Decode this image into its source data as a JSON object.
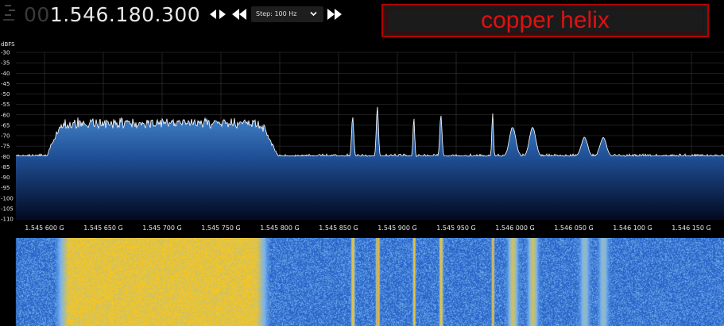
{
  "toolbar": {
    "frequency_leading": "00",
    "frequency_main": "1.546.180.300",
    "step_label": "Step: 100 Hz",
    "icons": [
      "menu-icon",
      "tune-left-right-icon",
      "rewind-icon",
      "chevron-down-icon",
      "fast-forward-icon"
    ]
  },
  "label_box": {
    "text": "copper helix",
    "color": "#e01010",
    "border_color": "#b30000"
  },
  "spectrum": {
    "unit": "dBFS",
    "y_ticks": [
      "-30",
      "-35",
      "-40",
      "-45",
      "-50",
      "-55",
      "-60",
      "-65",
      "-70",
      "-75",
      "-80",
      "-85",
      "-90",
      "-95",
      "-100",
      "-105",
      "-110"
    ],
    "y_range": [
      -110,
      -30
    ],
    "x_ticks": [
      "1.545 600 G",
      "1.545 650 G",
      "1.545 700 G",
      "1.545 750 G",
      "1.545 800 G",
      "1.545 850 G",
      "1.545 900 G",
      "1.545 950 G",
      "1.546 000 G",
      "1.546 050 G",
      "1.546 100 G",
      "1.546 150 G"
    ],
    "noise_floor_dbfs": -80,
    "wideband_signal": {
      "start_mhz": 1545.62,
      "end_mhz": 1545.78,
      "level_dbfs": -64
    },
    "narrow_peaks": [
      {
        "freq_mhz": 1545.862,
        "level_dbfs": -61,
        "width_khz": 2
      },
      {
        "freq_mhz": 1545.883,
        "level_dbfs": -56,
        "width_khz": 2
      },
      {
        "freq_mhz": 1545.914,
        "level_dbfs": -61,
        "width_khz": 1.5
      },
      {
        "freq_mhz": 1545.937,
        "level_dbfs": -60,
        "width_khz": 2
      },
      {
        "freq_mhz": 1545.981,
        "level_dbfs": -59,
        "width_khz": 1.5
      },
      {
        "freq_mhz": 1545.998,
        "level_dbfs": -66,
        "width_khz": 6
      },
      {
        "freq_mhz": 1546.015,
        "level_dbfs": -66,
        "width_khz": 6
      },
      {
        "freq_mhz": 1546.059,
        "level_dbfs": -71,
        "width_khz": 6
      },
      {
        "freq_mhz": 1546.075,
        "level_dbfs": -71,
        "width_khz": 6
      }
    ],
    "colors": {
      "fill_top": "#3f7fc4",
      "fill_bottom": "#030a20",
      "trace": "#ffffff",
      "grid": "#3a3a3a"
    }
  },
  "waterfall": {
    "colors": {
      "background": "#3a78d0",
      "strong": "#ffb400",
      "peak": "#ff4010"
    }
  }
}
